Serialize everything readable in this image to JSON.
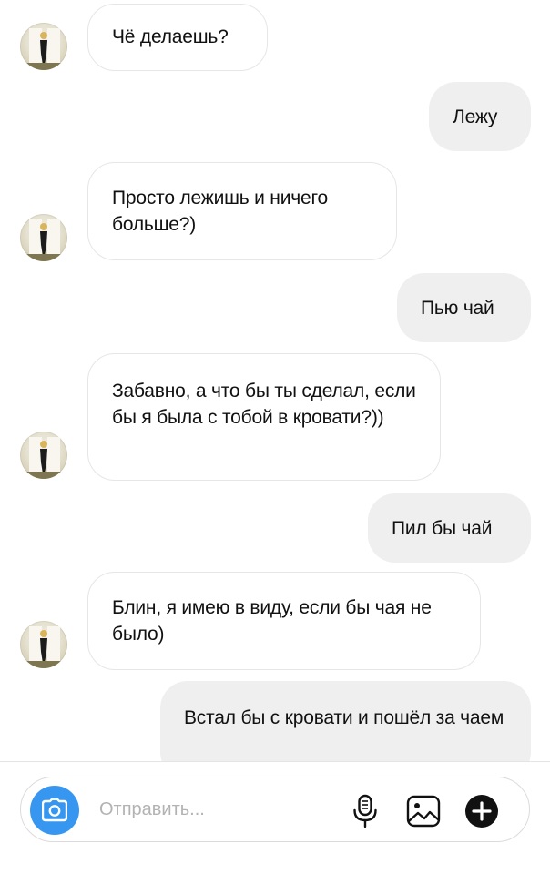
{
  "messages": [
    {
      "direction": "incoming",
      "text": "Чё делаешь?"
    },
    {
      "direction": "outgoing",
      "text": "Лежу"
    },
    {
      "direction": "incoming",
      "text": "Просто лежишь и ничего больше?)"
    },
    {
      "direction": "outgoing",
      "text": "Пью чай"
    },
    {
      "direction": "incoming",
      "text": "Забавно, а что бы ты сделал, если бы я была с тобой в кровати?))"
    },
    {
      "direction": "outgoing",
      "text": "Пил бы чай"
    },
    {
      "direction": "incoming",
      "text": "Блин, я имею в виду, если бы чая не было)"
    },
    {
      "direction": "outgoing",
      "text": "Встал бы с кровати и пошёл за чаем"
    }
  ],
  "composer": {
    "placeholder": "Отправить...",
    "icons": [
      "camera-icon",
      "microphone-icon",
      "gallery-icon",
      "plus-icon"
    ]
  },
  "colors": {
    "accent": "#3797f0",
    "outgoing_bubble": "#efefef",
    "incoming_border": "#e6e6e6",
    "placeholder": "#b3b3b3"
  }
}
